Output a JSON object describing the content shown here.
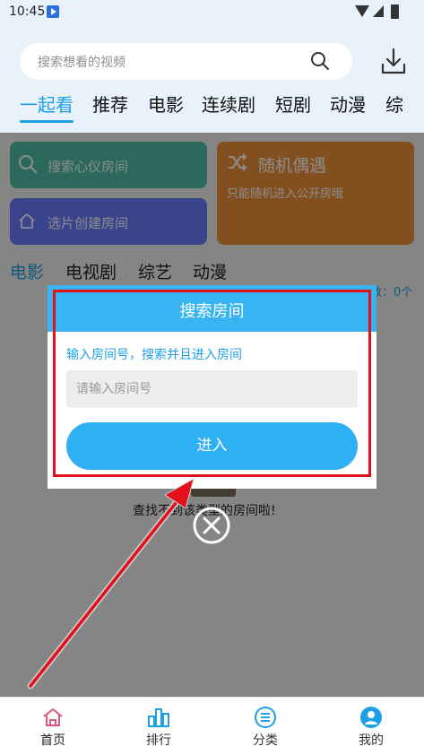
{
  "status_bar": {
    "time": "10:45"
  },
  "header": {
    "search_placeholder": "搜索想看的视频",
    "tabs": [
      "一起看",
      "推荐",
      "电影",
      "连续剧",
      "短剧",
      "动漫",
      "综"
    ],
    "active_tab": "一起看",
    "accent_color": "#1ea0e6"
  },
  "cards": {
    "search_room": "搜索心仪房间",
    "create_room": "选片创建房间",
    "random_title": "随机偶遇",
    "random_subtitle": "只能随机进入公开房哦",
    "colors": {
      "search": "#4fc0a8",
      "create": "#6a7cff",
      "random": "#f0913a"
    }
  },
  "categories": [
    "电影",
    "电视剧",
    "综艺",
    "动漫"
  ],
  "room_count": "数：0个",
  "empty_text": "查找不到该类型的房间啦!",
  "dialog": {
    "title": "搜索房间",
    "hint": "输入房间号，搜索并且进入房间",
    "input_placeholder": "请输入房间号",
    "input_value": "",
    "enter_label": "进入"
  },
  "bottom_nav": [
    {
      "label": "首页",
      "icon": "home-icon",
      "active": true
    },
    {
      "label": "排行",
      "icon": "ranking-icon",
      "active": false
    },
    {
      "label": "分类",
      "icon": "category-icon",
      "active": false
    },
    {
      "label": "我的",
      "icon": "profile-icon",
      "active": false
    }
  ]
}
